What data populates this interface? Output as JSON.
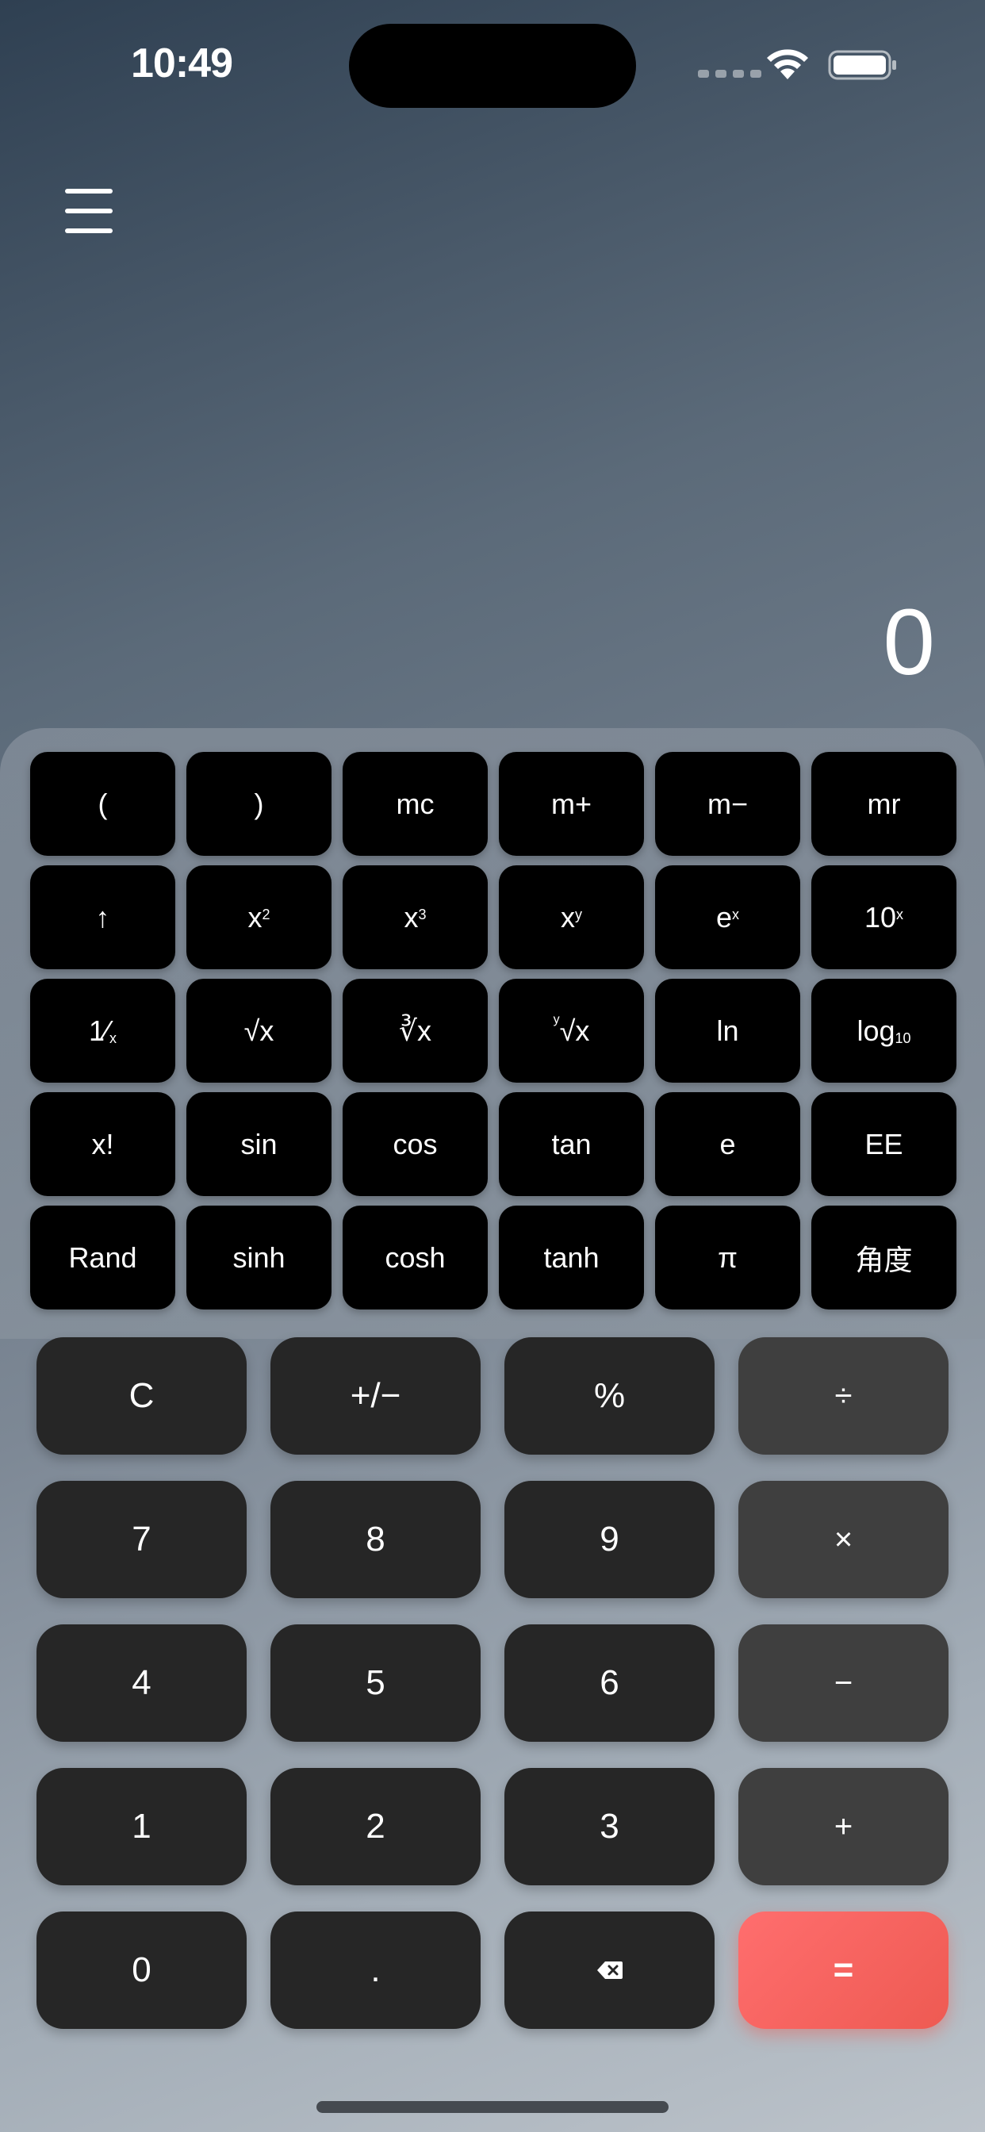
{
  "status_bar": {
    "time": "10:49",
    "icons": [
      "cellular-dots-icon",
      "wifi-icon",
      "battery-icon"
    ]
  },
  "header": {
    "menu_icon": "hamburger-menu-icon"
  },
  "display": {
    "value": "0"
  },
  "scientific_keys": [
    {
      "name": "open-paren",
      "label": "("
    },
    {
      "name": "close-paren",
      "label": ")"
    },
    {
      "name": "memory-clear",
      "label": "mc"
    },
    {
      "name": "memory-add",
      "label": "m+"
    },
    {
      "name": "memory-subtract",
      "label": "m−"
    },
    {
      "name": "memory-recall",
      "label": "mr"
    },
    {
      "name": "second-function",
      "label": "↑"
    },
    {
      "name": "square",
      "base": "x",
      "sup": "2"
    },
    {
      "name": "cube",
      "base": "x",
      "sup": "3"
    },
    {
      "name": "power",
      "base": "x",
      "sup": "y"
    },
    {
      "name": "exp",
      "base": "e",
      "sup": "x"
    },
    {
      "name": "ten-power",
      "base": "10",
      "sup": "x"
    },
    {
      "name": "reciprocal",
      "base": "1⁄",
      "sub": "x"
    },
    {
      "name": "square-root",
      "label": "√x"
    },
    {
      "name": "cube-root",
      "label": "∛x"
    },
    {
      "name": "y-root",
      "lead": "y",
      "base": "√x"
    },
    {
      "name": "natural-log",
      "label": "ln"
    },
    {
      "name": "log-base-10",
      "base": "log",
      "sub": "10"
    },
    {
      "name": "factorial",
      "label": "x!"
    },
    {
      "name": "sine",
      "label": "sin"
    },
    {
      "name": "cosine",
      "label": "cos"
    },
    {
      "name": "tangent",
      "label": "tan"
    },
    {
      "name": "euler",
      "label": "e"
    },
    {
      "name": "scientific-notation",
      "label": "EE"
    },
    {
      "name": "random",
      "label": "Rand"
    },
    {
      "name": "hyperbolic-sine",
      "label": "sinh"
    },
    {
      "name": "hyperbolic-cosine",
      "label": "cosh"
    },
    {
      "name": "hyperbolic-tangent",
      "label": "tanh"
    },
    {
      "name": "pi",
      "label": "π"
    },
    {
      "name": "angle-mode",
      "label": "角度"
    }
  ],
  "basic_keys": [
    {
      "name": "clear",
      "label": "C",
      "style": "num"
    },
    {
      "name": "sign-toggle",
      "label": "+/−",
      "style": "num"
    },
    {
      "name": "percent",
      "label": "%",
      "style": "num"
    },
    {
      "name": "divide",
      "label": "÷",
      "style": "op"
    },
    {
      "name": "digit-7",
      "label": "7",
      "style": "num"
    },
    {
      "name": "digit-8",
      "label": "8",
      "style": "num"
    },
    {
      "name": "digit-9",
      "label": "9",
      "style": "num"
    },
    {
      "name": "multiply",
      "label": "×",
      "style": "op"
    },
    {
      "name": "digit-4",
      "label": "4",
      "style": "num"
    },
    {
      "name": "digit-5",
      "label": "5",
      "style": "num"
    },
    {
      "name": "digit-6",
      "label": "6",
      "style": "num"
    },
    {
      "name": "subtract",
      "label": "−",
      "style": "op"
    },
    {
      "name": "digit-1",
      "label": "1",
      "style": "num"
    },
    {
      "name": "digit-2",
      "label": "2",
      "style": "num"
    },
    {
      "name": "digit-3",
      "label": "3",
      "style": "num"
    },
    {
      "name": "add",
      "label": "+",
      "style": "op"
    },
    {
      "name": "digit-0",
      "label": "0",
      "style": "num"
    },
    {
      "name": "decimal-point",
      "label": ".",
      "style": "num"
    },
    {
      "name": "backspace",
      "icon": "backspace-icon",
      "style": "num"
    },
    {
      "name": "equals",
      "label": "=",
      "style": "equals"
    }
  ],
  "colors": {
    "sci_key_bg": "#000000",
    "num_key_bg": "#262626",
    "op_key_bg": "#3f3f3f",
    "equals_start": "#ff6e6e",
    "equals_end": "#ee5a52"
  }
}
